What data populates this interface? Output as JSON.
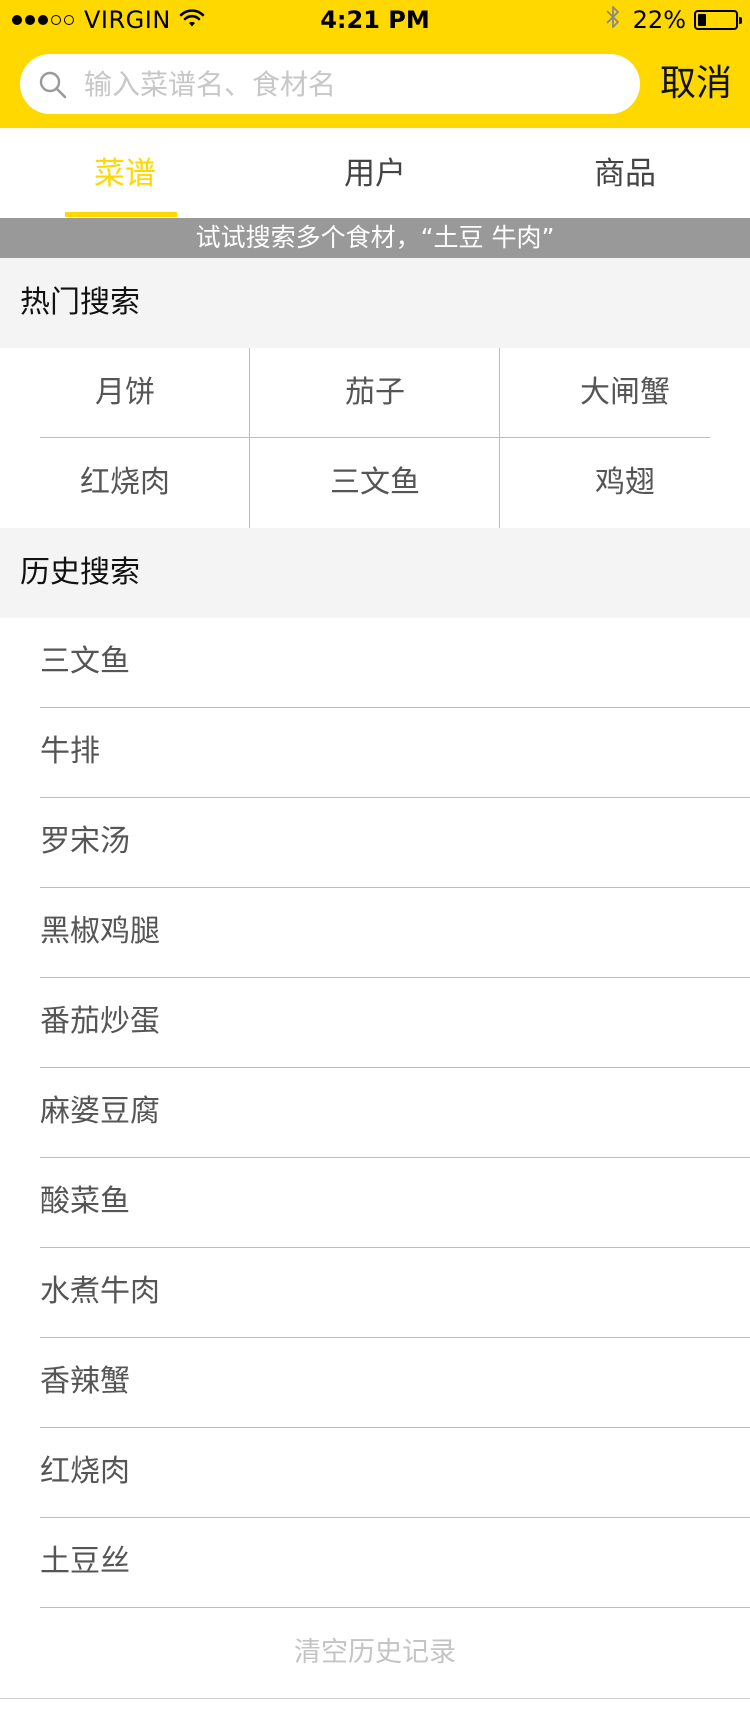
{
  "status_bar": {
    "carrier": "VIRGIN",
    "time": "4:21 PM",
    "battery_percent": "22%",
    "battery_level": 0.22,
    "signal_full": 3,
    "signal_total": 5,
    "icons": [
      "wifi-icon",
      "bluetooth-icon",
      "battery-icon"
    ]
  },
  "search": {
    "placeholder": "输入菜谱名、食材名",
    "value": "",
    "cancel_label": "取消",
    "icon": "search-icon"
  },
  "tabs": [
    {
      "label": "菜谱",
      "active": true
    },
    {
      "label": "用户",
      "active": false
    },
    {
      "label": "商品",
      "active": false
    }
  ],
  "hint": "试试搜索多个食材，“土豆 牛肉”",
  "hot_search": {
    "title": "热门搜索",
    "items": [
      "月饼",
      "茄子",
      "大闸蟹",
      "红烧肉",
      "三文鱼",
      "鸡翅"
    ]
  },
  "history": {
    "title": "历史搜索",
    "items": [
      "三文鱼",
      "牛排",
      "罗宋汤",
      "黑椒鸡腿",
      "番茄炒蛋",
      "麻婆豆腐",
      "酸菜鱼",
      "水煮牛肉",
      "香辣蟹",
      "红烧肉",
      "土豆丝"
    ],
    "clear_label": "清空历史记录"
  },
  "colors": {
    "accent": "#ffd800",
    "hint_bg": "#999999",
    "section_bg": "#f4f4f4",
    "text_muted": "#555555",
    "clear_text": "#c4c4c4"
  }
}
